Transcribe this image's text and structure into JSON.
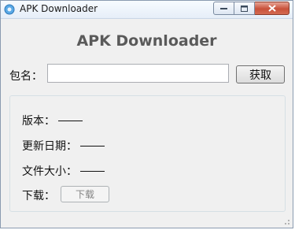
{
  "window": {
    "title": "APK Downloader"
  },
  "main": {
    "heading": "APK Downloader",
    "package_label": "包名：",
    "package_value": "",
    "fetch_button": "获取"
  },
  "info": {
    "version_label": "版本：",
    "update_date_label": "更新日期：",
    "file_size_label": "文件大小：",
    "download_label": "下载：",
    "download_button": "下载"
  },
  "icons": [
    "app-icon",
    "minimize-icon",
    "maximize-icon",
    "close-icon"
  ]
}
